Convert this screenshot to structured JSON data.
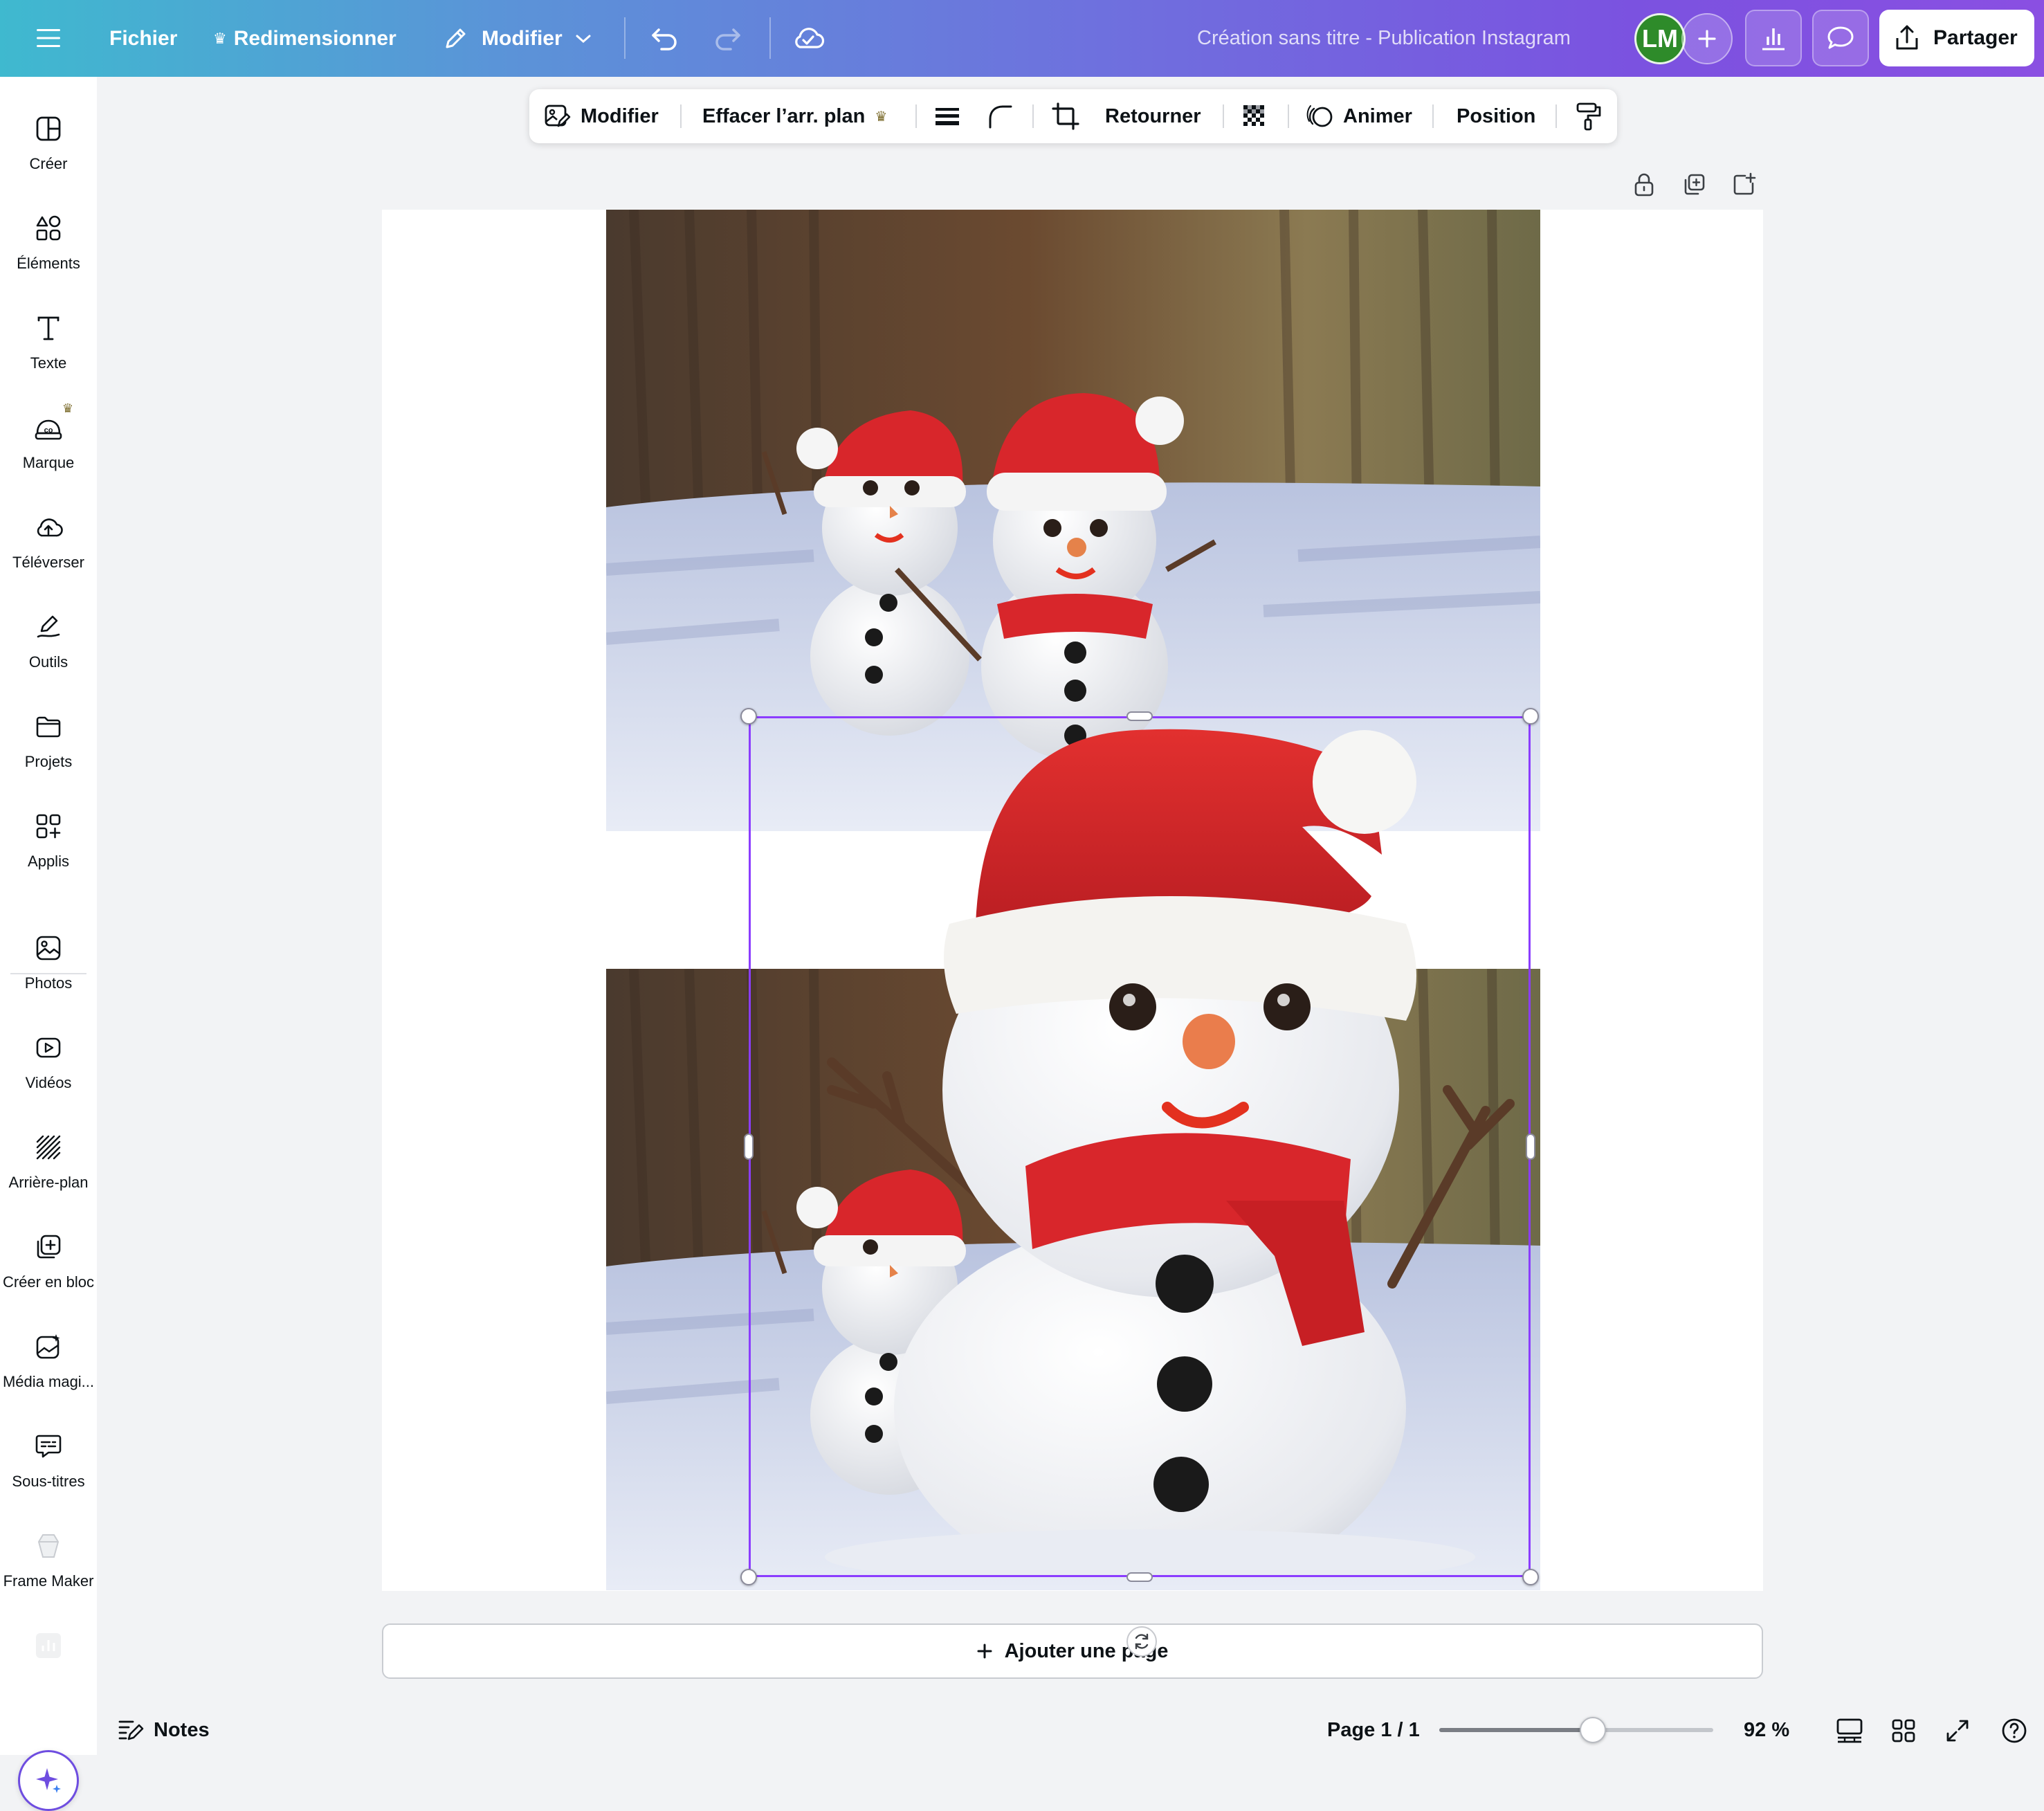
{
  "topbar": {
    "menu_icon": "hamburger-menu-icon",
    "file_label": "Fichier",
    "resize_label": "Redimensionner",
    "edit_label": "Modifier",
    "doc_title": "Création sans titre - Publication Instagram",
    "avatar_initials": "LM",
    "share_label": "Partager"
  },
  "sidebar": {
    "items": [
      {
        "label": "Créer",
        "icon": "layout-icon"
      },
      {
        "label": "Éléments",
        "icon": "shapes-icon"
      },
      {
        "label": "Texte",
        "icon": "text-icon"
      },
      {
        "label": "Marque",
        "icon": "brand-icon"
      },
      {
        "label": "Téléverser",
        "icon": "cloud-upload-icon"
      },
      {
        "label": "Outils",
        "icon": "draw-tool-icon"
      },
      {
        "label": "Projets",
        "icon": "folder-icon"
      },
      {
        "label": "Applis",
        "icon": "apps-icon"
      },
      {
        "label": "Photos",
        "icon": "photo-icon"
      },
      {
        "label": "Vidéos",
        "icon": "video-icon"
      },
      {
        "label": "Arrière-plan",
        "icon": "background-icon"
      },
      {
        "label": "Créer en bloc",
        "icon": "bulk-create-icon"
      },
      {
        "label": "Média magi...",
        "icon": "magic-media-icon"
      },
      {
        "label": "Sous-titres",
        "icon": "captions-icon"
      },
      {
        "label": "Frame Maker",
        "icon": "frame-maker-icon"
      }
    ]
  },
  "context_toolbar": {
    "edit_label": "Modifier",
    "bg_remove_label": "Effacer l’arr. plan",
    "flip_label": "Retourner",
    "animate_label": "Animer",
    "position_label": "Position"
  },
  "canvas": {
    "add_page_label": "Ajouter une page"
  },
  "bottombar": {
    "notes_label": "Notes",
    "page_indicator": "Page 1 / 1",
    "zoom_label": "92 %",
    "zoom_fraction": 0.56
  },
  "colors": {
    "selection": "#8b3dff",
    "avatar_bg": "#2e8b2a",
    "hat_red": "#d8262b"
  }
}
